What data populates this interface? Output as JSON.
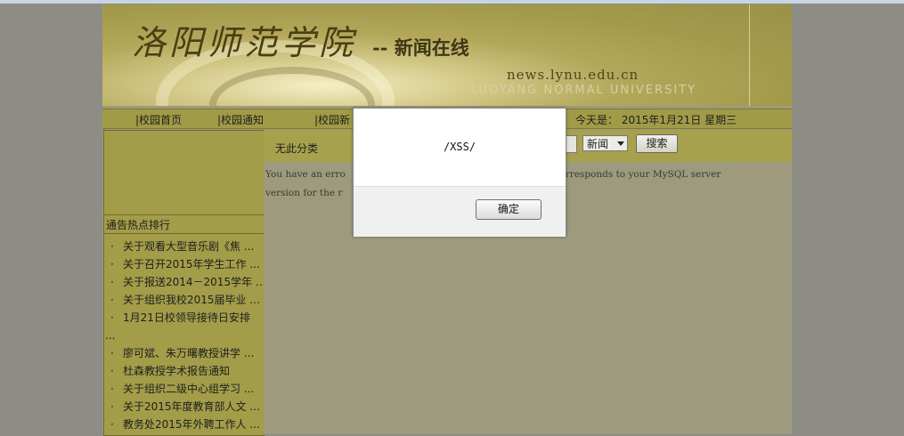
{
  "header": {
    "title": "洛阳师范学院",
    "subtitle": "-- 新闻在线",
    "url": "news.lynu.edu.cn",
    "english_name": "LUOYANG NORMAL UNIVERSITY"
  },
  "nav": {
    "items": [
      {
        "label": "|校园首页"
      },
      {
        "label": "|校园通知"
      },
      {
        "label": "|校园新"
      }
    ],
    "date_label": "今天是： 2015年1月21日 星期三"
  },
  "sidebar": {
    "hot_title": "通告热点排行",
    "bullet": "·",
    "hot_items": [
      {
        "label": "关于观看大型音乐剧《焦 ..."
      },
      {
        "label": "关于召开2015年学生工作 ..."
      },
      {
        "label": "关于报送2014－2015学年 ..."
      },
      {
        "label": "关于组织我校2015届毕业 ..."
      },
      {
        "label": "1月21日校领导接待日安排"
      },
      {
        "label": "..."
      },
      {
        "label": "廖可斌、朱万曙教授讲学 ..."
      },
      {
        "label": "杜森教授学术报告通知"
      },
      {
        "label": "关于组织二级中心组学习 ..."
      },
      {
        "label": "关于2015年度教育部人文 ..."
      },
      {
        "label": "教务处2015年外聘工作人 ..."
      }
    ]
  },
  "main": {
    "category_label": "无此分类",
    "search": {
      "select_value": "新闻",
      "button_label": "搜索"
    },
    "error_line1": "You have an erro",
    "error_line1_tail": "hat corresponds to your MySQL server",
    "error_line2": "version for the r"
  },
  "dialog": {
    "message": "/XSS/",
    "ok_label": "确定"
  },
  "colors": {
    "page_bg": "#8d8c85",
    "nav_bg": "#a19b47",
    "content_bg": "#9d9a7e"
  }
}
